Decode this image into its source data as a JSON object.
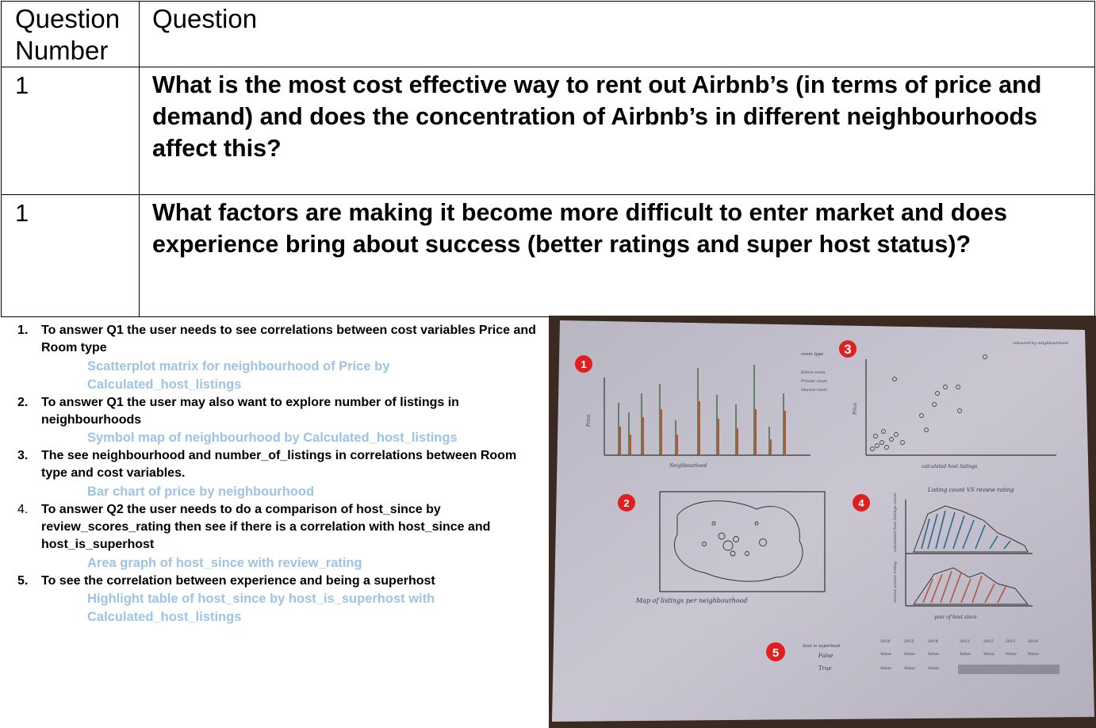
{
  "table": {
    "header": {
      "col1": "Question Number",
      "col2": "Question"
    },
    "rows": [
      {
        "number": "1",
        "question": "What is the most cost effective way to rent out Airbnb’s (in terms of price and demand) and does the concentration of Airbnb’s in different neighbourhoods affect this?"
      },
      {
        "number": "1",
        "question": "What factors are making it become more difficult to enter market and does experience bring about success (better ratings and super host status)?"
      }
    ]
  },
  "tasks": [
    {
      "number": "1.",
      "text": "To answer Q1 the user needs to see correlations between cost variables Price and Room type",
      "viz": "Scatterplot matrix for neighbourhood of Price by Calculated_host_listings"
    },
    {
      "number": "2.",
      "text": "To answer Q1 the user may also want to explore number of listings in neighbourhoods",
      "viz": "Symbol map of neighbourhood by Calculated_host_listings"
    },
    {
      "number": "3.",
      "text": "The see neighbourhood and number_of_listings in correlations between Room type and cost variables.",
      "viz": "Bar chart of price by neighbourhood"
    },
    {
      "number": "4.",
      "text": "To answer Q2 the user needs to do a comparison of host_since by review_scores_rating then see if there is a correlation with host_since and host_is_superhost",
      "viz": "Area graph of host_since with review_rating"
    },
    {
      "number": "5.",
      "text": "To see the correlation between experience and being a superhost",
      "viz": "Highlight table of host_since by host_is_superhost with Calculated_host_listings"
    }
  ],
  "sketch": {
    "markers": [
      "1",
      "2",
      "3",
      "4",
      "5"
    ],
    "labels": {
      "price_axis": "Price",
      "neighbourhood_axis": "Neighbourhood",
      "legend_title": "room type",
      "legend_items": [
        "Entire room",
        "Private room",
        "Shared room"
      ],
      "scatter_y": "Price",
      "scatter_x": "calculated host listings",
      "scatter_note": "coloured by neighbourhood",
      "map_caption": "Map of listings per neighbourhood",
      "area_title": "Listing count VS review rating",
      "area_y1": "calculated host listings count",
      "area_y2": "review scores rating",
      "area_x": "year of host since",
      "table_row_header": "host is superhost",
      "table_rows": [
        "False",
        "True"
      ],
      "table_years": [
        "2016",
        "2015",
        "2014",
        "2013",
        "2012",
        "2011",
        "2010"
      ],
      "table_cell": "Value"
    }
  }
}
